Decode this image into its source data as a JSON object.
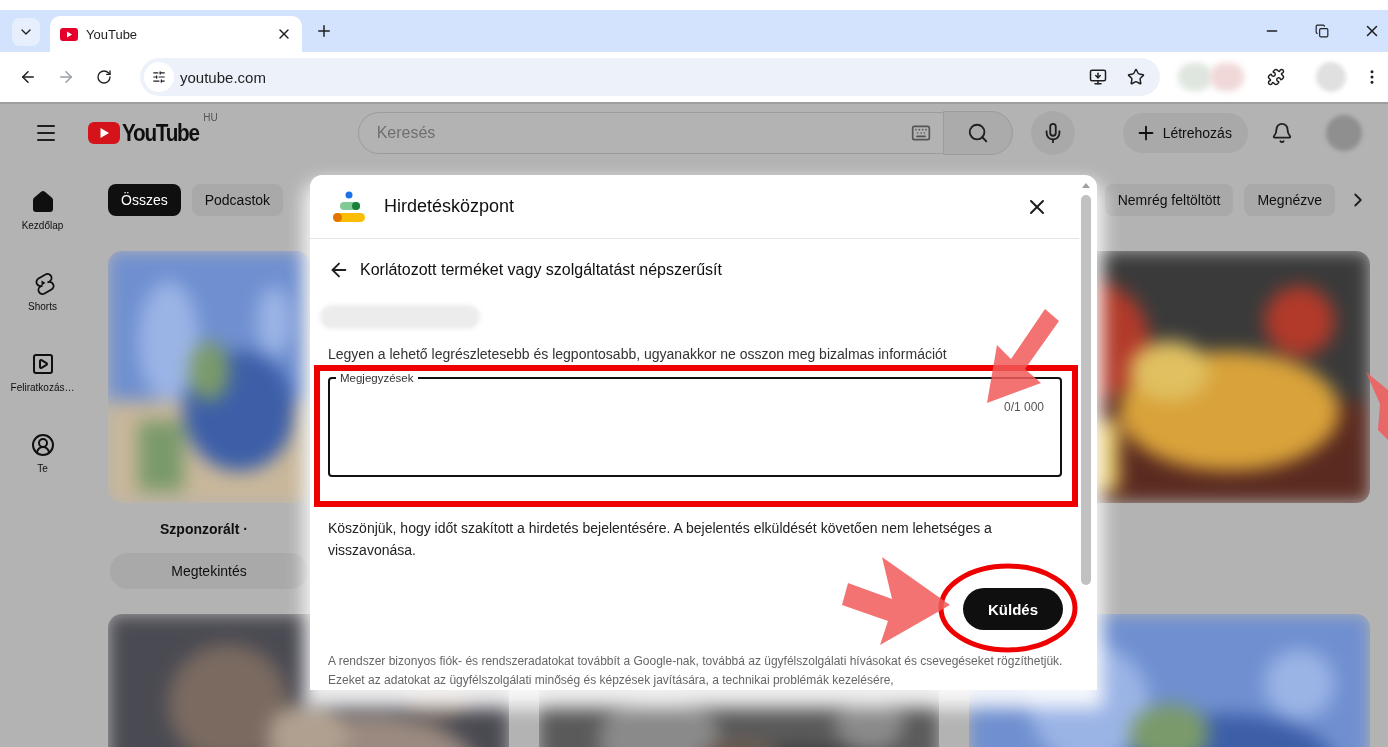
{
  "browser": {
    "tab_title": "YouTube",
    "address": "youtube.com"
  },
  "header": {
    "logo_text": "YouTube",
    "region": "HU",
    "search": {
      "placeholder": "Keresés"
    },
    "create_label": "Létrehozás"
  },
  "sidebar": [
    {
      "kind": "home",
      "label": "Kezdőlap"
    },
    {
      "kind": "shorts",
      "label": "Shorts"
    },
    {
      "kind": "subscriptions",
      "label": "Feliratkozás…"
    },
    {
      "kind": "you",
      "label": "Te"
    }
  ],
  "chips_left": [
    {
      "label": "Összes",
      "selected": true
    },
    {
      "label": "Podcastok",
      "selected": false
    }
  ],
  "chips_right": [
    {
      "label": "Nemrég feltöltött",
      "selected": false
    },
    {
      "label": "Megnézve",
      "selected": false
    }
  ],
  "feed_rows": [
    [
      {
        "kind": "ad",
        "label": "Szponzorált ·",
        "button": "Megtekintés"
      },
      {
        "kind": "video"
      }
    ],
    [
      {
        "kind": "video"
      },
      {
        "kind": "video"
      },
      {
        "kind": "video"
      }
    ]
  ],
  "dialog": {
    "title": "Hirdetésközpont",
    "heading": "Korlátozott terméket vagy szolgáltatást népszerűsít",
    "instruction": "Legyen a lehető legrészletesebb és legpontosabb, ugyanakkor ne osszon meg bizalmas információt",
    "notes": {
      "label": "Megjegyzések",
      "counter": "0/1 000"
    },
    "thanks": "Köszönjük, hogy időt szakított a hirdetés bejelentésére. A bejelentés elküldését követően nem lehetséges a visszavonása.",
    "submit": "Küldés",
    "disclaimer": "A rendszer bizonyos fiók- és rendszeradatokat továbbít a Google-nak, továbbá az ügyfélszolgálati hívásokat és csevegéseket rögzíthetjük. Ezeket az adatokat az ügyfélszolgálati minőség és képzések javítására, a technikai problémák kezelésére,"
  }
}
